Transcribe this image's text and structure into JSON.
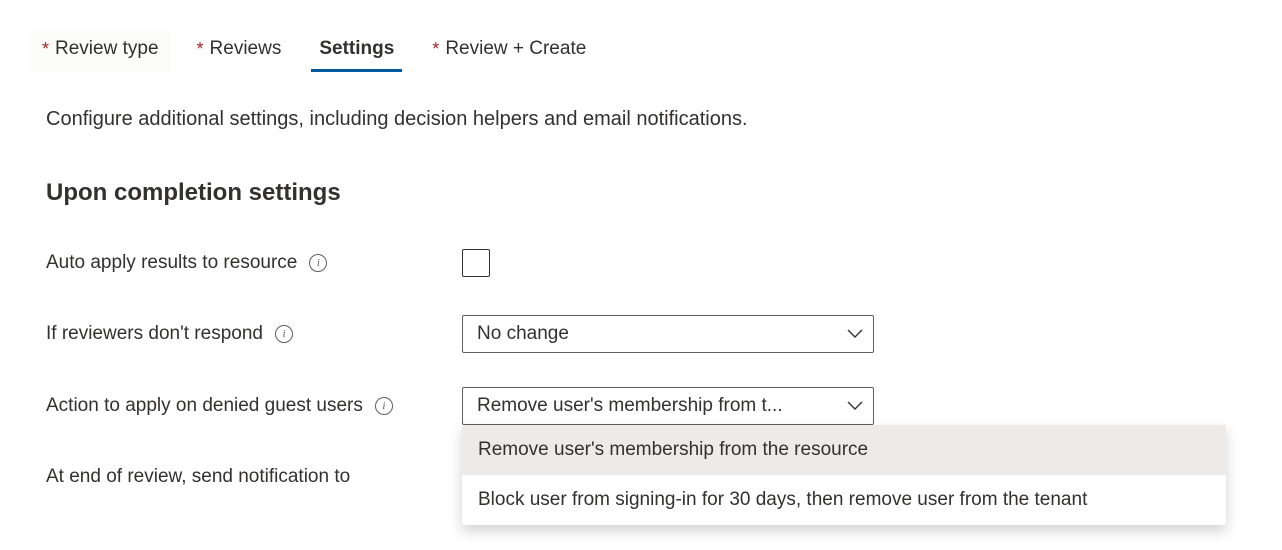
{
  "tabs": {
    "review_type": "Review type",
    "reviews": "Reviews",
    "settings": "Settings",
    "review_create": "Review + Create"
  },
  "description": "Configure additional settings, including decision helpers and email notifications.",
  "section": {
    "heading": "Upon completion settings"
  },
  "fields": {
    "auto_apply": {
      "label": "Auto apply results to resource"
    },
    "if_reviewers": {
      "label": "If reviewers don't respond",
      "selected": "No change"
    },
    "action_denied": {
      "label": "Action to apply on denied guest users",
      "selected_display": "Remove user's membership from t...",
      "options": [
        "Remove user's membership from the resource",
        "Block user from signing-in for 30 days, then remove user from the tenant"
      ]
    },
    "end_notify": {
      "label": "At end of review, send notification to"
    }
  }
}
